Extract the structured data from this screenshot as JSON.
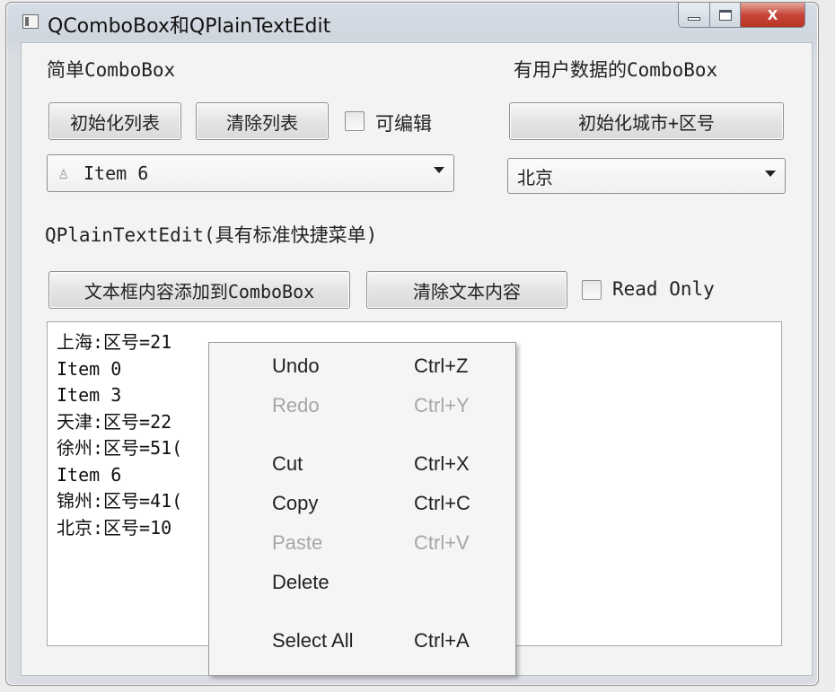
{
  "window": {
    "title": "QComboBox和QPlainTextEdit",
    "close_glyph": "X"
  },
  "simple_combo_section": {
    "title": "简单ComboBox",
    "init_list_button": "初始化列表",
    "clear_list_button": "清除列表",
    "editable_label": "可编辑",
    "editable_checked": false,
    "combo_value": "Item 6",
    "combo_icon": "person-icon"
  },
  "user_data_combo_section": {
    "title": "有用户数据的ComboBox",
    "init_city_button": "初始化城市+区号",
    "combo_value": "北京"
  },
  "plain_text_section": {
    "title": "QPlainTextEdit(具有标准快捷菜单)",
    "add_to_combo_button": "文本框内容添加到ComboBox",
    "clear_text_button": "清除文本内容",
    "read_only_label": "Read Only",
    "read_only_checked": false,
    "lines": [
      "上海:区号=21",
      "Item 0",
      "Item 3",
      "天津:区号=22",
      "徐州:区号=51(",
      "Item 6",
      "锦州:区号=41(",
      "北京:区号=10"
    ]
  },
  "context_menu": {
    "items": [
      {
        "label": "Undo",
        "shortcut": "Ctrl+Z",
        "enabled": true
      },
      {
        "label": "Redo",
        "shortcut": "Ctrl+Y",
        "enabled": false
      },
      {
        "label": "Cut",
        "shortcut": "Ctrl+X",
        "enabled": true
      },
      {
        "label": "Copy",
        "shortcut": "Ctrl+C",
        "enabled": true
      },
      {
        "label": "Paste",
        "shortcut": "Ctrl+V",
        "enabled": false
      },
      {
        "label": "Delete",
        "shortcut": "",
        "enabled": true
      },
      {
        "label": "Select All",
        "shortcut": "Ctrl+A",
        "enabled": true
      }
    ]
  }
}
